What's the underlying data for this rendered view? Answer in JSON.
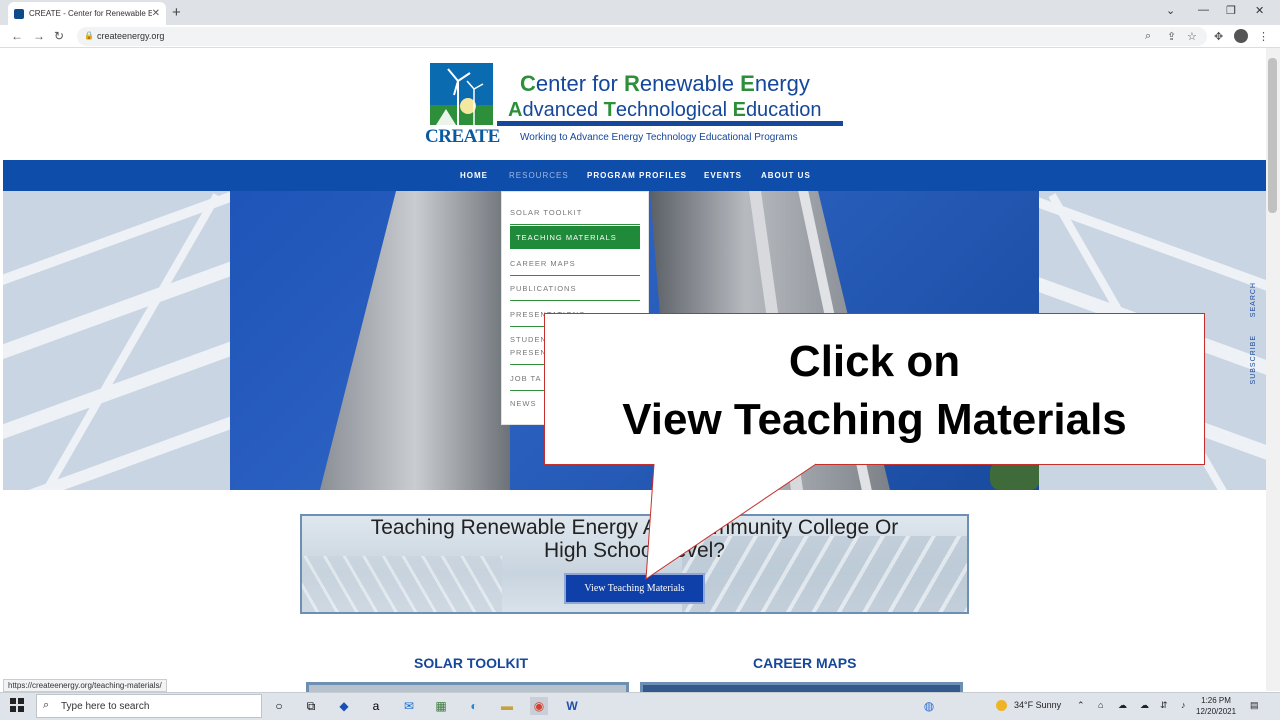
{
  "browser": {
    "tab_title": "CREATE - Center for Renewable E",
    "url": "createenergy.org",
    "status_url": "https://createenergy.org/teaching-materials/"
  },
  "logo": {
    "mark_text": "CREATE",
    "line1": {
      "c": "C",
      "a": "enter for ",
      "r": "R",
      "b": "enewable ",
      "e": "E",
      "d": "nergy"
    },
    "line2": {
      "a1": "A",
      "a": "dvanced ",
      "t": "T",
      "b": "echnological ",
      "e": "E",
      "d": "ducation"
    },
    "tagline": "Working to Advance Energy Technology Educational Programs"
  },
  "nav": {
    "home": "HOME",
    "resources": "RESOURCES",
    "program_profiles": "PROGRAM PROFILES",
    "events": "EVENTS",
    "about_us": "ABOUT US"
  },
  "dropdown": {
    "solar_toolkit": "SOLAR TOOLKIT",
    "teaching_materials": "TEACHING MATERIALS",
    "career_maps": "CAREER MAPS",
    "publications": "PUBLICATIONS",
    "presentations": "PRESENTATIONS",
    "student_a": "STUDENT",
    "student_b": "PRESEN",
    "job": "JOB TA",
    "news": "NEWS"
  },
  "callout": {
    "line1": "Click on",
    "line2": "View Teaching Materials"
  },
  "banner": {
    "line1": "Teaching Renewable Energy At a Community College Or",
    "line2": "High School Level?",
    "button": "View Teaching Materials"
  },
  "sections": {
    "solar_toolkit": "SOLAR TOOLKIT",
    "career_maps": "CAREER MAPS"
  },
  "side": {
    "search": "SEARCH",
    "subscribe": "SUBSCRIBE"
  },
  "taskbar": {
    "search_placeholder": "Type here to search",
    "weather": "34°F  Sunny",
    "time": "1:26 PM",
    "date": "12/20/2021"
  }
}
